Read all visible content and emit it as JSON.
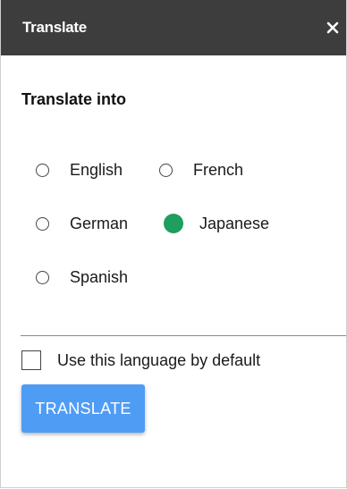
{
  "dialog": {
    "title": "Translate",
    "close_glyph": "×"
  },
  "section": {
    "heading": "Translate into"
  },
  "languages": [
    {
      "label": "English",
      "selected": false
    },
    {
      "label": "French",
      "selected": false
    },
    {
      "label": "German",
      "selected": false
    },
    {
      "label": "Japanese",
      "selected": true
    },
    {
      "label": "Spanish",
      "selected": false
    }
  ],
  "default_option": {
    "label": "Use this language by default",
    "checked": false
  },
  "action": {
    "translate_label": "TRANSLATE"
  },
  "colors": {
    "titlebar": "#3d3d3d",
    "selected_radio": "#1e9e5f",
    "primary_button": "#4f9cf5"
  }
}
